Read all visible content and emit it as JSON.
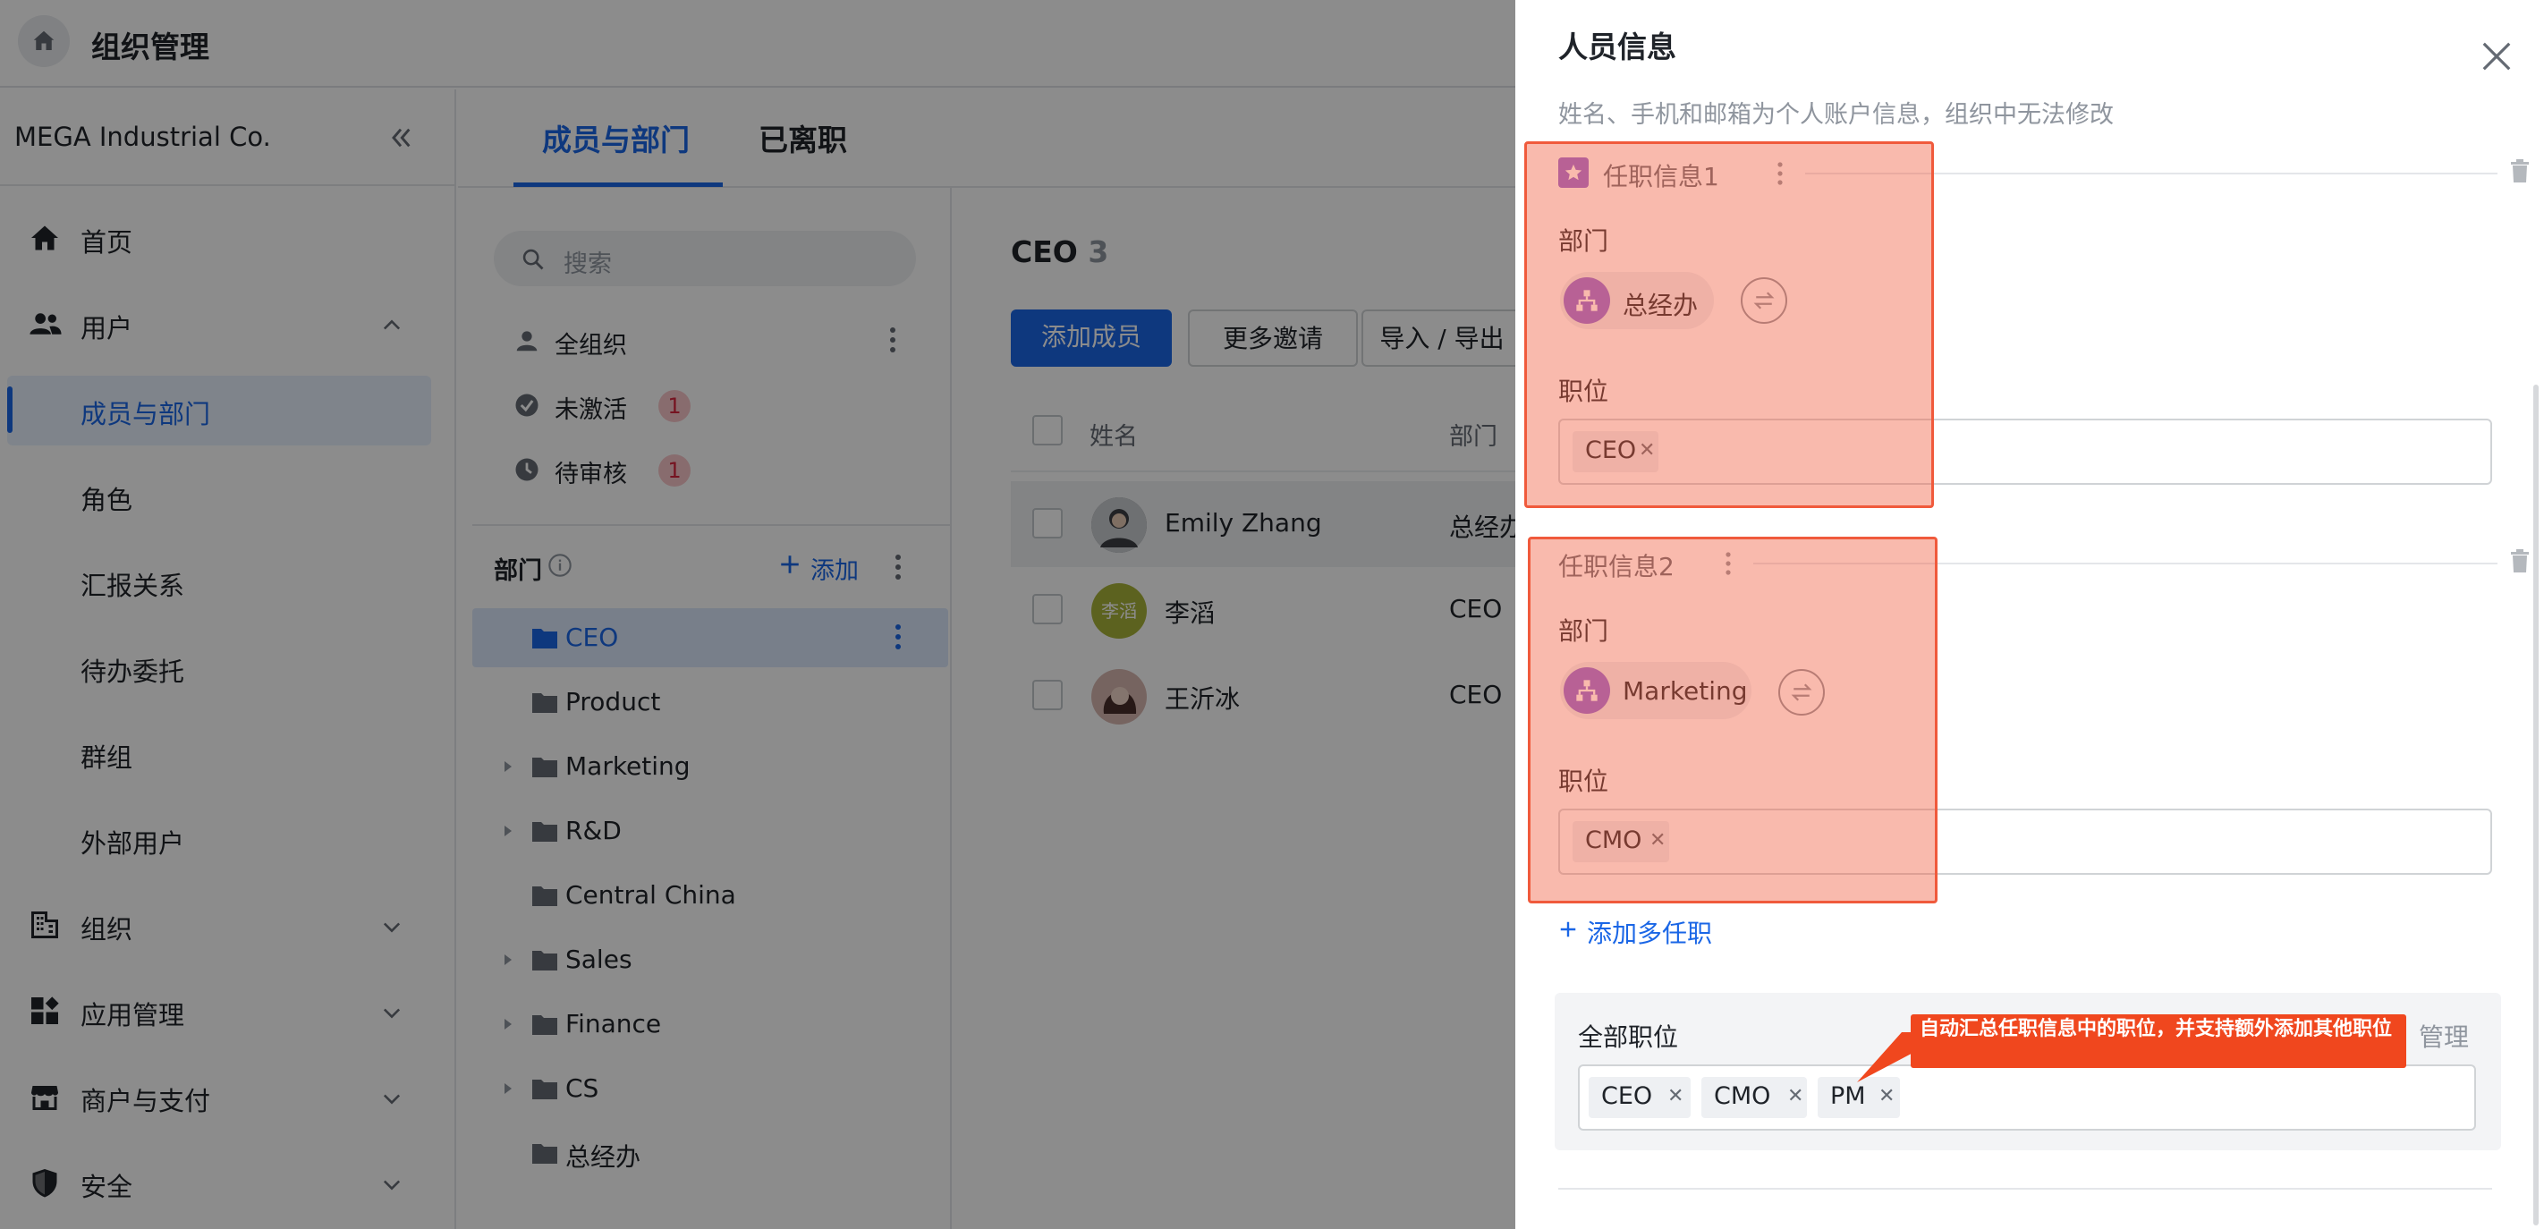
{
  "app": {
    "title": "组织管理"
  },
  "sidebar": {
    "company": "MEGA Industrial Co.",
    "items": [
      {
        "label": "首页",
        "icon": "home-icon"
      },
      {
        "label": "用户",
        "icon": "users-icon",
        "expanded": true,
        "children": [
          "成员与部门",
          "角色",
          "汇报关系",
          "待办委托",
          "群组",
          "外部用户"
        ],
        "active_child": "成员与部门"
      },
      {
        "label": "组织",
        "icon": "building-icon"
      },
      {
        "label": "应用管理",
        "icon": "apps-icon"
      },
      {
        "label": "商户与支付",
        "icon": "store-icon"
      },
      {
        "label": "安全",
        "icon": "shield-icon"
      }
    ]
  },
  "tabs": [
    "成员与部门",
    "已离职"
  ],
  "dept_panel": {
    "search_placeholder": "搜索",
    "filters": [
      {
        "label": "全组织"
      },
      {
        "label": "未激活",
        "badge": "1"
      },
      {
        "label": "待审核",
        "badge": "1"
      }
    ],
    "header": "部门",
    "add_label": "添加",
    "tree": [
      {
        "label": "CEO",
        "active": true,
        "expandable": false
      },
      {
        "label": "Product",
        "expandable": false
      },
      {
        "label": "Marketing",
        "expandable": true
      },
      {
        "label": "R&D",
        "expandable": true
      },
      {
        "label": "Central China",
        "expandable": false
      },
      {
        "label": "Sales",
        "expandable": true
      },
      {
        "label": "Finance",
        "expandable": true
      },
      {
        "label": "CS",
        "expandable": true
      },
      {
        "label": "总经办",
        "expandable": false
      }
    ]
  },
  "member_area": {
    "heading": "CEO",
    "count": "3",
    "buttons": {
      "add": "添加成员",
      "more": "更多邀请",
      "import": "导入 / 导出"
    },
    "columns": {
      "name": "姓名",
      "dept": "部门"
    },
    "rows": [
      {
        "name": "Emily Zhang",
        "dept": "总经办"
      },
      {
        "name": "李滔",
        "dept": "CEO",
        "avatar_text": "李滔"
      },
      {
        "name": "王沂冰",
        "dept": "CEO"
      }
    ]
  },
  "drawer": {
    "title": "人员信息",
    "subtitle": "姓名、手机和邮箱为个人账户信息，组织中无法修改",
    "jobs": [
      {
        "title": "任职信息1",
        "primary": true,
        "dept_label": "部门",
        "dept": "总经办",
        "pos_label": "职位",
        "positions": [
          "CEO"
        ]
      },
      {
        "title": "任职信息2",
        "primary": false,
        "dept_label": "部门",
        "dept": "Marketing",
        "pos_label": "职位",
        "positions": [
          "CMO"
        ]
      }
    ],
    "add_multi": "添加多任职",
    "all_positions": {
      "label": "全部职位",
      "manage": "管理",
      "tags": [
        "CEO",
        "CMO",
        "PM"
      ]
    },
    "callout": "自动汇总任职信息中的职位，并支持额外添加其他职位"
  },
  "colors": {
    "accent": "#1a66e6",
    "highlight_box": "#f05a3c",
    "dept_avatar": "#8f67d6",
    "callout": "#f0471e"
  }
}
